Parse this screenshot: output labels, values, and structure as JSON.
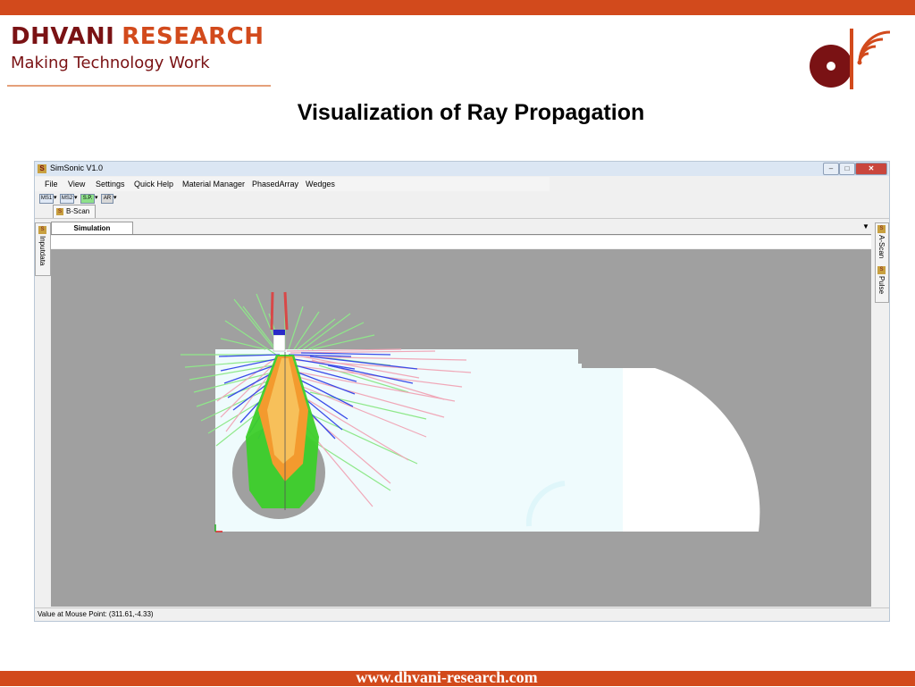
{
  "slide": {
    "brand_name_1": "DHVANI",
    "brand_name_2": "RESEARCH",
    "brand_tagline": "Making Technology Work",
    "title": "Visualization of Ray Propagation",
    "footer_url": "www.dhvani-research.com",
    "colors": {
      "accent": "#d24a1c",
      "brand_dark": "#7a1214"
    }
  },
  "app": {
    "window_title": "SimSonic V1.0",
    "menu": [
      "File",
      "View",
      "Settings",
      "Quick Help",
      "Material Manager",
      "PhasedArray",
      "Wedges"
    ],
    "toolbar": [
      "MS1",
      "MS2",
      "S.P.",
      "AR"
    ],
    "doc_tab": "B-Scan",
    "view_tab": "Simulation",
    "left_panel": "Inputdata",
    "right_panels": [
      "A-Scan",
      "Pulse"
    ],
    "status": "Value at Mouse Point: (311.61,-4.33)",
    "icon_letter": "S"
  }
}
